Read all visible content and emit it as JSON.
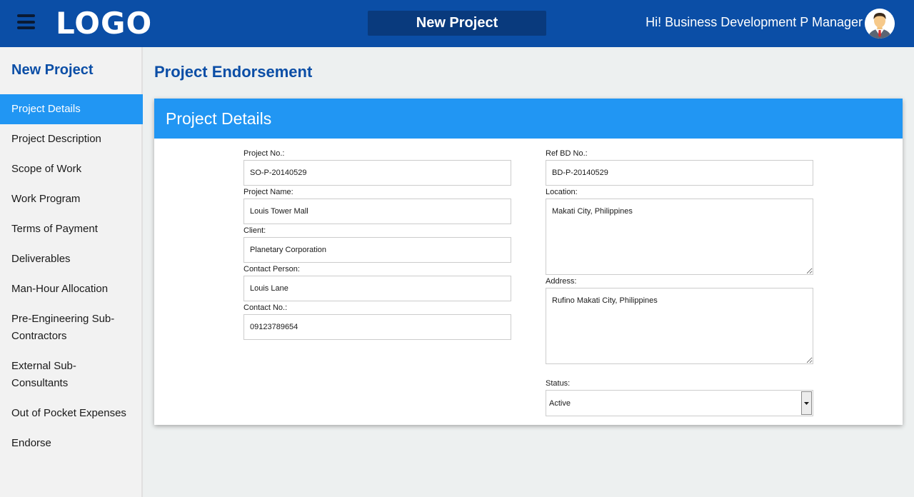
{
  "header": {
    "logo": "LOGO",
    "title": "New Project",
    "greeting": "Hi! Business Development P Manager"
  },
  "sidebar": {
    "heading": "New Project",
    "items": [
      {
        "label": "Project Details",
        "active": true
      },
      {
        "label": "Project Description"
      },
      {
        "label": "Scope of Work"
      },
      {
        "label": "Work Program"
      },
      {
        "label": "Terms of Payment"
      },
      {
        "label": "Deliverables"
      },
      {
        "label": "Man-Hour Allocation"
      },
      {
        "label": "Pre-Engineering Sub-Contractors"
      },
      {
        "label": "External Sub-Consultants"
      },
      {
        "label": "Out of Pocket Expenses"
      },
      {
        "label": "Endorse"
      }
    ]
  },
  "main": {
    "page_title": "Project Endorsement",
    "card_title": "Project Details",
    "fields": {
      "project_no": {
        "label": "Project No.:",
        "value": "SO-P-20140529"
      },
      "project_name": {
        "label": "Project Name:",
        "value": "Louis Tower Mall"
      },
      "client": {
        "label": "Client:",
        "value": "Planetary Corporation"
      },
      "contact_person": {
        "label": "Contact Person:",
        "value": "Louis Lane"
      },
      "contact_no": {
        "label": "Contact No.:",
        "value": "09123789654"
      },
      "ref_bd_no": {
        "label": "Ref BD No.:",
        "value": "BD-P-20140529"
      },
      "location": {
        "label": "Location:",
        "value": "Makati City, Philippines"
      },
      "address": {
        "label": "Address:",
        "value": "Rufino Makati City, Philippines"
      },
      "status": {
        "label": "Status:",
        "value": "Active"
      }
    }
  },
  "colors": {
    "header_bg": "#0b4ea6",
    "accent": "#2196f3",
    "heading_text": "#0b4ea6",
    "page_bg": "#edf0f0"
  },
  "icons": {
    "menu": "hamburger-menu-icon",
    "avatar": "user-avatar",
    "dropdown": "chevron-down-icon"
  }
}
